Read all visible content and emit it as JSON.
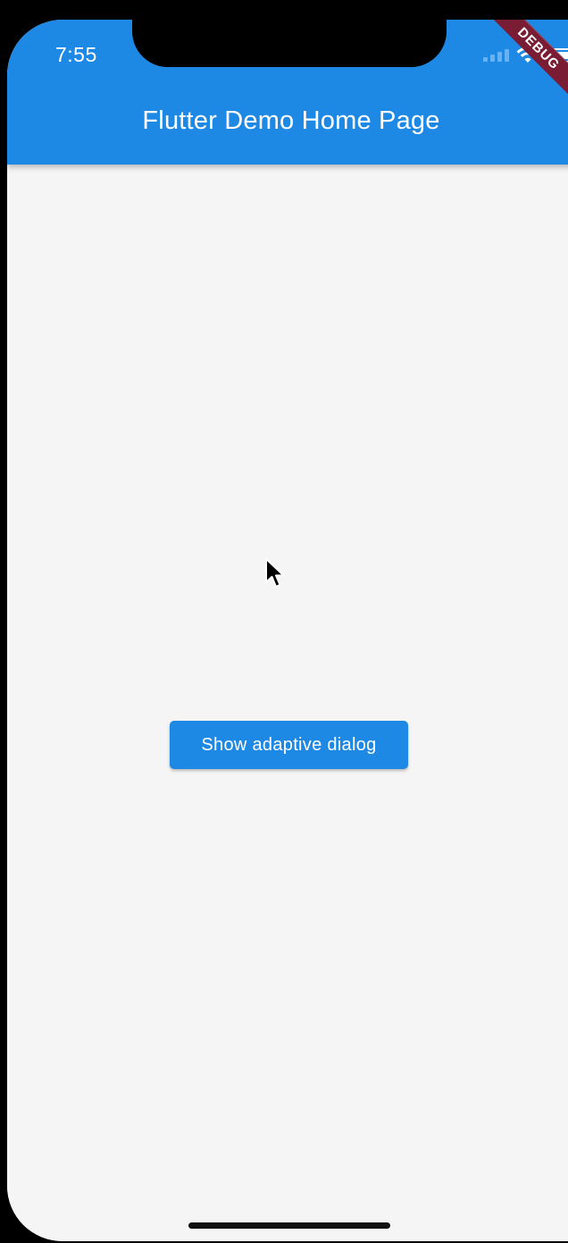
{
  "status_bar": {
    "time": "7:55",
    "wifi_icon": "wifi-icon",
    "battery_icon": "battery-icon"
  },
  "app_bar": {
    "title": "Flutter Demo Home Page",
    "color": "#1e88e5"
  },
  "debug_banner": {
    "label": "DEBUG",
    "color": "#7a1d34"
  },
  "main": {
    "button_label": "Show adaptive dialog",
    "background": "#f5f5f5"
  }
}
